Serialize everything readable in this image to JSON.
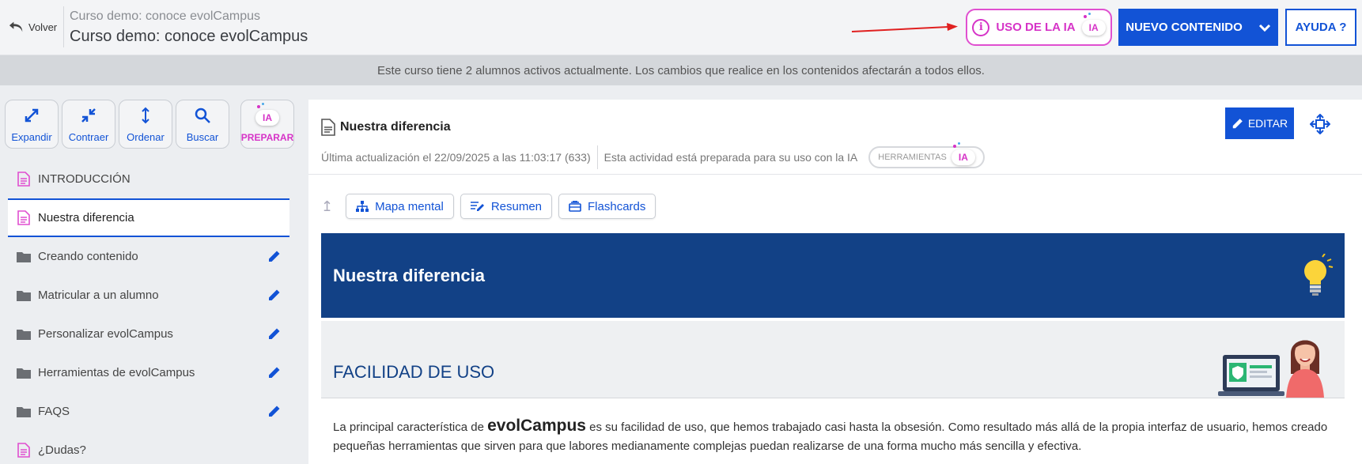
{
  "header": {
    "back_label": "Volver",
    "breadcrumb_small": "Curso demo: conoce evolCampus",
    "title": "Curso demo: conoce evolCampus",
    "ia_button": "USO DE LA IA",
    "ia_badge": "IA",
    "new_content_button": "NUEVO CONTENIDO",
    "help_button": "AYUDA ?"
  },
  "notice": "Este curso tiene 2 alumnos activos actualmente. Los cambios que realice en los contenidos afectarán a todos ellos.",
  "sidebar": {
    "tools": {
      "expand": "Expandir",
      "collapse": "Contraer",
      "sort": "Ordenar",
      "search": "Buscar",
      "prepare": "PREPARAR"
    },
    "items": [
      {
        "label": "INTRODUCCIÓN",
        "icon": "document-icon"
      },
      {
        "label": "Nuestra diferencia",
        "icon": "document-icon"
      },
      {
        "label": "Creando contenido",
        "icon": "folder-icon"
      },
      {
        "label": "Matricular a un alumno",
        "icon": "folder-icon"
      },
      {
        "label": "Personalizar evolCampus",
        "icon": "folder-icon"
      },
      {
        "label": "Herramientas de evolCampus",
        "icon": "folder-icon"
      },
      {
        "label": "FAQS",
        "icon": "folder-icon"
      },
      {
        "label": "¿Dudas?",
        "icon": "document-icon"
      }
    ]
  },
  "content": {
    "title": "Nuestra diferencia",
    "last_update": "Última actualización el 22/09/2025 a las 11:03:17 (633)",
    "ia_ready": "Esta actividad está preparada para su uso con la IA",
    "tools_pill": "HERRAMIENTAS",
    "edit_button": "EDITAR",
    "actions": {
      "mind_map": "Mapa mental",
      "summary": "Resumen",
      "flashcards": "Flashcards"
    },
    "banner_title": "Nuestra diferencia",
    "section_title": "FACILIDAD DE USO",
    "paragraph_pre": "La principal característica de ",
    "paragraph_brand": "evolCampus",
    "paragraph_post": " es su facilidad de uso, que hemos trabajado casi hasta la obsesión. Como resultado más allá de la propia interfaz de usuario, hemos creado pequeñas herramientas que sirven para que labores medianamente complejas puedan realizarse de una forma mucho más sencilla y efectiva."
  },
  "colors": {
    "primary": "#1253d6",
    "ia_magenta": "#d633c7",
    "banner": "#124186",
    "annotation_arrow": "#e02020"
  }
}
